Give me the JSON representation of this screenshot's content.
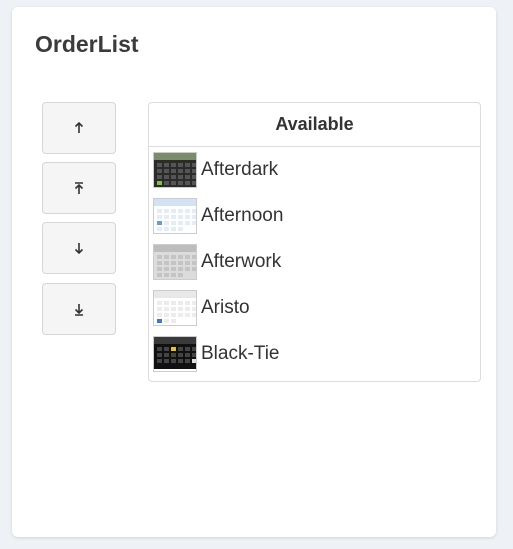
{
  "panel": {
    "title": "OrderList"
  },
  "controls": [
    {
      "name": "move-up-button",
      "icon": "arrow-up-icon"
    },
    {
      "name": "move-top-button",
      "icon": "arrow-to-top-icon"
    },
    {
      "name": "move-down-button",
      "icon": "arrow-down-icon"
    },
    {
      "name": "move-bottom-button",
      "icon": "arrow-to-bottom-icon"
    }
  ],
  "list": {
    "header": "Available",
    "items": [
      {
        "label": "Afterdark",
        "theme": "afterdark-thumbnail"
      },
      {
        "label": "Afternoon",
        "theme": "afternoon-thumbnail"
      },
      {
        "label": "Afterwork",
        "theme": "afterwork-thumbnail"
      },
      {
        "label": "Aristo",
        "theme": "aristo-thumbnail"
      },
      {
        "label": "Black-Tie",
        "theme": "black-tie-thumbnail"
      }
    ]
  },
  "colors": {
    "background": "#eef1f5",
    "card": "#ffffff",
    "button_bg": "#f5f5f5",
    "border": "#d6d6d6"
  }
}
